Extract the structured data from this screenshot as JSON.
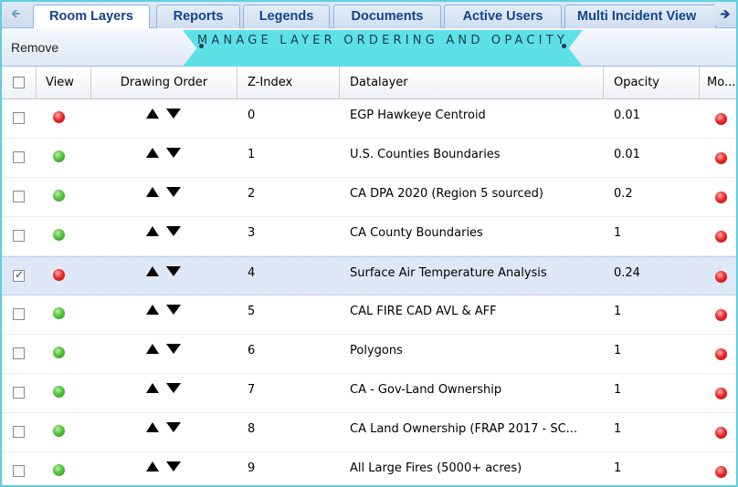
{
  "tabs": [
    {
      "label": "Room Layers",
      "active": true
    },
    {
      "label": "Reports",
      "active": false
    },
    {
      "label": "Legends",
      "active": false
    },
    {
      "label": "Documents",
      "active": false
    },
    {
      "label": "Active Users",
      "active": false
    },
    {
      "label": "Multi Incident View",
      "active": false
    }
  ],
  "tab_scroll_icons": {
    "left": "arrow-left-icon",
    "right": "arrow-right-icon"
  },
  "toolbar": {
    "remove_label": "Remove"
  },
  "banner": {
    "text": "MANAGE LAYER ORDERING AND OPACITY",
    "color": "#5ee0e8"
  },
  "grid": {
    "headers": {
      "view": "View",
      "drawing_order": "Drawing Order",
      "z_index": "Z-Index",
      "datalayer": "Datalayer",
      "opacity": "Opacity",
      "more": "Mo..."
    },
    "rows": [
      {
        "checked": false,
        "view": "red",
        "z_index": "0",
        "datalayer": "EGP Hawkeye Centroid",
        "opacity": "0.01",
        "more": "red"
      },
      {
        "checked": false,
        "view": "green",
        "z_index": "1",
        "datalayer": "U.S. Counties Boundaries",
        "opacity": "0.01",
        "more": "red"
      },
      {
        "checked": false,
        "view": "green",
        "z_index": "2",
        "datalayer": "CA DPA 2020 (Region 5 sourced)",
        "opacity": "0.2",
        "more": "red"
      },
      {
        "checked": false,
        "view": "green",
        "z_index": "3",
        "datalayer": "CA County Boundaries",
        "opacity": "1",
        "more": "red"
      },
      {
        "checked": true,
        "view": "red",
        "z_index": "4",
        "datalayer": "Surface Air Temperature Analysis",
        "opacity": "0.24",
        "more": "red",
        "selected": true
      },
      {
        "checked": false,
        "view": "green",
        "z_index": "5",
        "datalayer": "CAL FIRE CAD AVL & AFF",
        "opacity": "1",
        "more": "red"
      },
      {
        "checked": false,
        "view": "green",
        "z_index": "6",
        "datalayer": "Polygons",
        "opacity": "1",
        "more": "red"
      },
      {
        "checked": false,
        "view": "green",
        "z_index": "7",
        "datalayer": "CA - Gov-Land Ownership",
        "opacity": "1",
        "more": "red"
      },
      {
        "checked": false,
        "view": "green",
        "z_index": "8",
        "datalayer": "CA Land Ownership (FRAP 2017 - SC...",
        "opacity": "1",
        "more": "red"
      },
      {
        "checked": false,
        "view": "green",
        "z_index": "9",
        "datalayer": "All Large Fires (5000+ acres)",
        "opacity": "1",
        "more": "red"
      }
    ]
  },
  "colors": {
    "view_on": "#57c240",
    "view_off": "#ee2a2a",
    "tab_text": "#15428b",
    "selected_row": "#dfe8f6"
  }
}
